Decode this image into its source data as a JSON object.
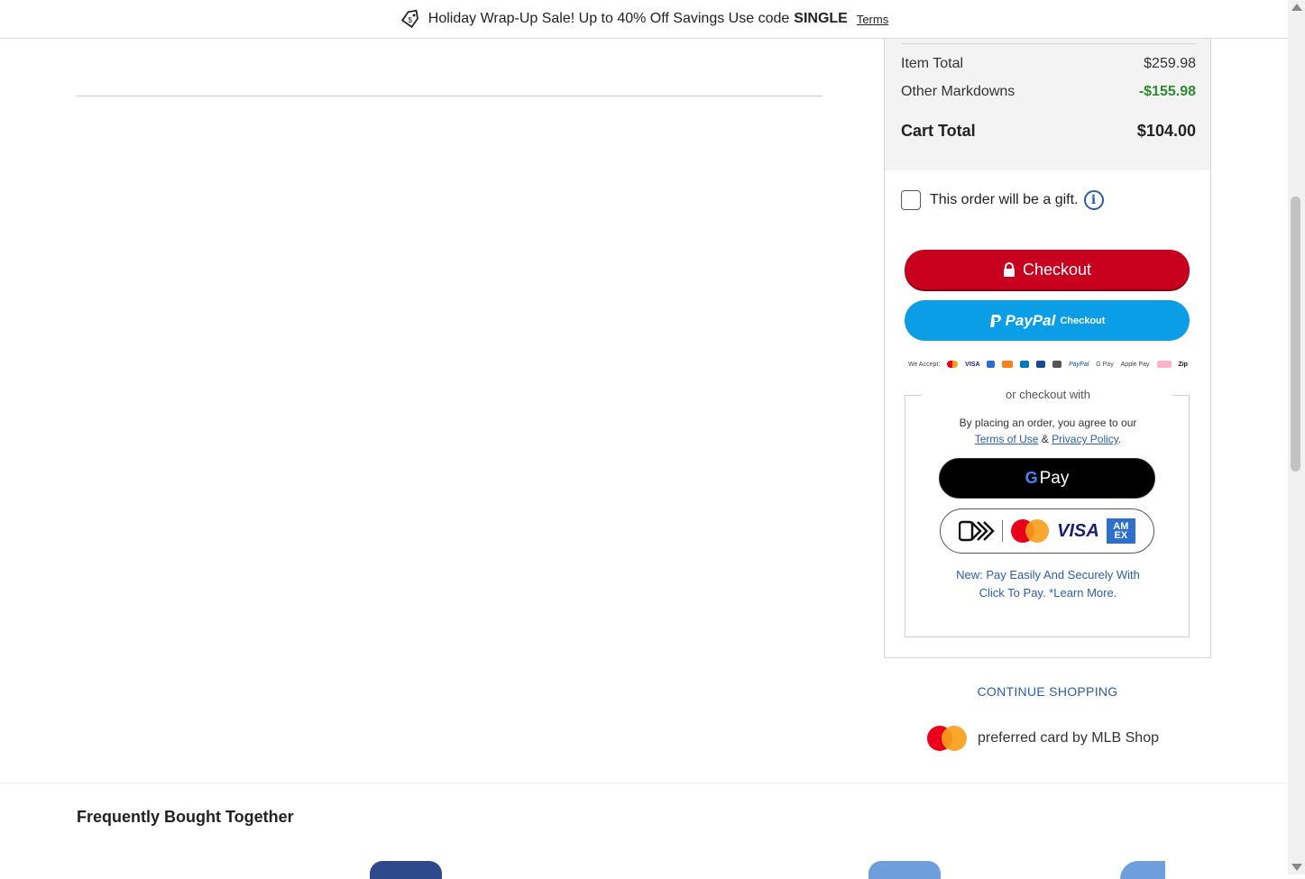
{
  "promo_bar": {
    "text": "Holiday Wrap-Up Sale! Up to 40% Off Savings Use code",
    "code": "SINGLE",
    "terms_link": "Terms"
  },
  "order_summary": {
    "item_total_label": "Item Total",
    "item_total_value": "$259.98",
    "other_markdowns_label": "Other Markdowns",
    "other_markdowns_value": "-$155.98",
    "cart_total_label": "Cart Total",
    "cart_total_value": "$104.00",
    "colors": {
      "markdown": "#2e8b2e",
      "checkout": "#c8001e",
      "paypal": "#0b9de6",
      "link": "#2a5ea8"
    }
  },
  "gift": {
    "label": "This order will be a gift.",
    "checked": false,
    "info_icon": "i"
  },
  "buttons": {
    "checkout_label": "Checkout",
    "paypal_brand": "PayPal",
    "paypal_label": "Checkout"
  },
  "accepted_payments": {
    "label": "We Accept:",
    "methods": [
      "Mastercard",
      "VISA",
      "Amex",
      "Discover",
      "Diners",
      "JCB",
      "Click to Pay",
      "PayPal",
      "G Pay",
      "Apple Pay",
      "Klarna",
      "Zip"
    ]
  },
  "alt_checkout": {
    "legend": "or checkout with",
    "agree_text": "By placing an order, you agree to our",
    "terms_link": "Terms of Use",
    "ampersand": "&",
    "privacy_link": "Privacy Policy",
    "period": ".",
    "gpay_g": "G",
    "gpay_label": "Pay",
    "visa_text": "VISA",
    "amex_text": "AM EX",
    "new_pay_text": "New: Pay Easily And Securely With Click To Pay. *Learn More."
  },
  "continue_shopping": "CONTINUE SHOPPING",
  "preferred_card": "preferred card by MLB Shop",
  "frequently_bought": {
    "title": "Frequently Bought Together"
  }
}
